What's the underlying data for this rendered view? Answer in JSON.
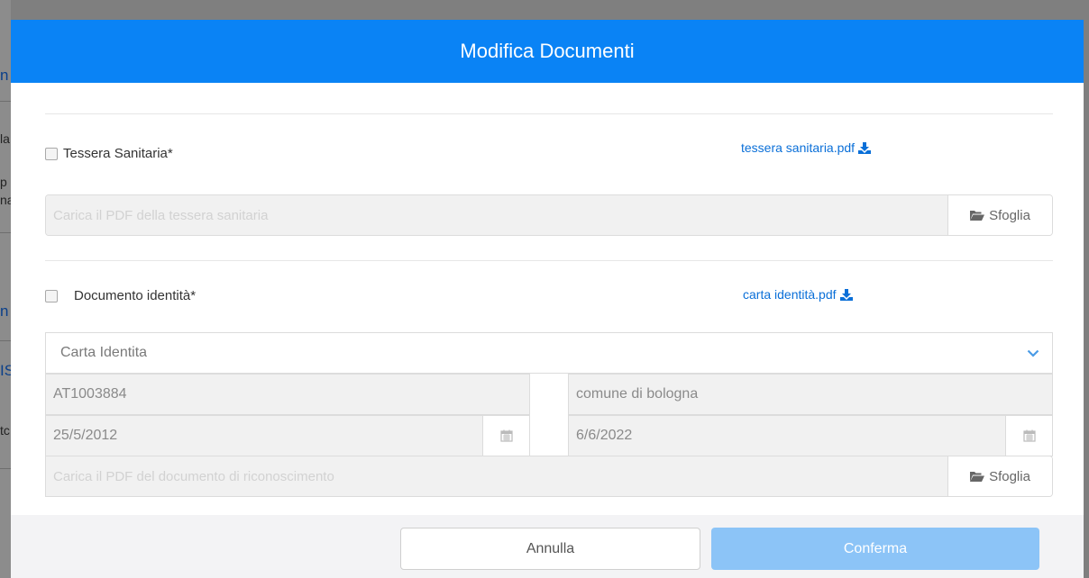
{
  "background": {
    "fragments": [
      "n",
      "la",
      "p",
      "na",
      "n",
      "IS",
      "tc"
    ]
  },
  "modal": {
    "title": "Modifica Documenti",
    "health_card": {
      "label": "Tessera Sanitaria*",
      "checked": false,
      "download_link": "tessera sanitaria.pdf",
      "file_placeholder": "Carica il PDF della tessera sanitaria",
      "browse_label": "Sfoglia"
    },
    "identity_document": {
      "label": "Documento identità*",
      "checked": false,
      "download_link": "carta identità.pdf",
      "document_type": "Carta Identita",
      "number": "AT1003884",
      "issued_by": "comune di bologna",
      "issue_date": "25/5/2012",
      "expiry_date": "6/6/2022",
      "file_placeholder": "Carica il PDF del documento di riconoscimento",
      "browse_label": "Sfoglia"
    },
    "footer": {
      "cancel_label": "Annulla",
      "confirm_label": "Conferma"
    }
  },
  "colors": {
    "header": "#0a83f5",
    "link": "#0a6fd8",
    "confirm_disabled": "#8cc4f7"
  },
  "icons": [
    "download-icon",
    "folder-open-icon",
    "chevron-down-icon",
    "calendar-icon"
  ]
}
